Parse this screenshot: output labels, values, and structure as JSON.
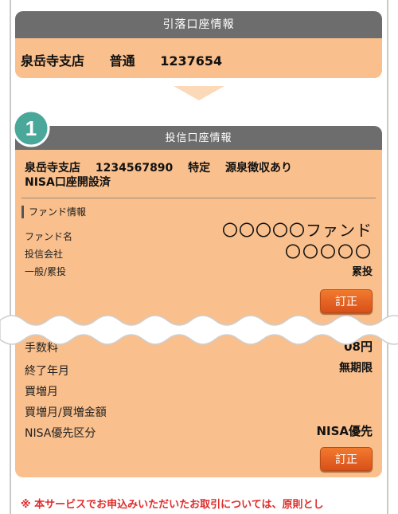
{
  "debit_account": {
    "header": "引落口座情報",
    "branch": "泉岳寺支店",
    "account_type": "普通",
    "account_number": "1237654"
  },
  "step_badge": "1",
  "investment_account": {
    "header": "投信口座情報",
    "branch": "泉岳寺支店",
    "account_number": "1234567890",
    "account_kind": "特定",
    "withholding": "源泉徴収あり",
    "nisa_status": "NISA口座開設済"
  },
  "fund_info": {
    "section_label": "ファンド情報",
    "fund_name_label": "ファンド名",
    "fund_name_value": "〇〇〇〇〇ファンド",
    "company_label": "投信会社",
    "company_value": "〇〇〇〇〇",
    "type_label": "一般/累投",
    "type_value": "累投",
    "edit_label": "訂正"
  },
  "partial": {
    "label_fragment": "手数料",
    "value_fragment": "08円"
  },
  "details": {
    "end_month_label": "終了年月",
    "end_month_value": "無期限",
    "increase_month_label": "買増月",
    "increase_amount_label": "買増月/買増金額",
    "nisa_priority_label": "NISA優先区分",
    "nisa_priority_value": "NISA優先",
    "edit_label": "訂正"
  },
  "notice": "※ 本サービスでお申込みいただいたお取引については、原則とし"
}
